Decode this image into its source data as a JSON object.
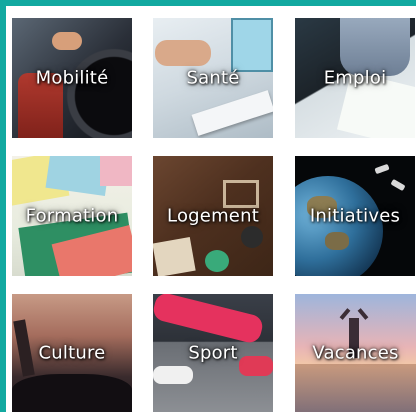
{
  "colors": {
    "frame": "#12a9a0",
    "panel": "#ffffff",
    "label": "#ffffff"
  },
  "tiles": [
    {
      "label": "Mobilité"
    },
    {
      "label": "Santé"
    },
    {
      "label": "Emploi"
    },
    {
      "label": "Formation"
    },
    {
      "label": "Logement"
    },
    {
      "label": "Initiatives"
    },
    {
      "label": "Culture"
    },
    {
      "label": "Sport"
    },
    {
      "label": "Vacances"
    }
  ]
}
